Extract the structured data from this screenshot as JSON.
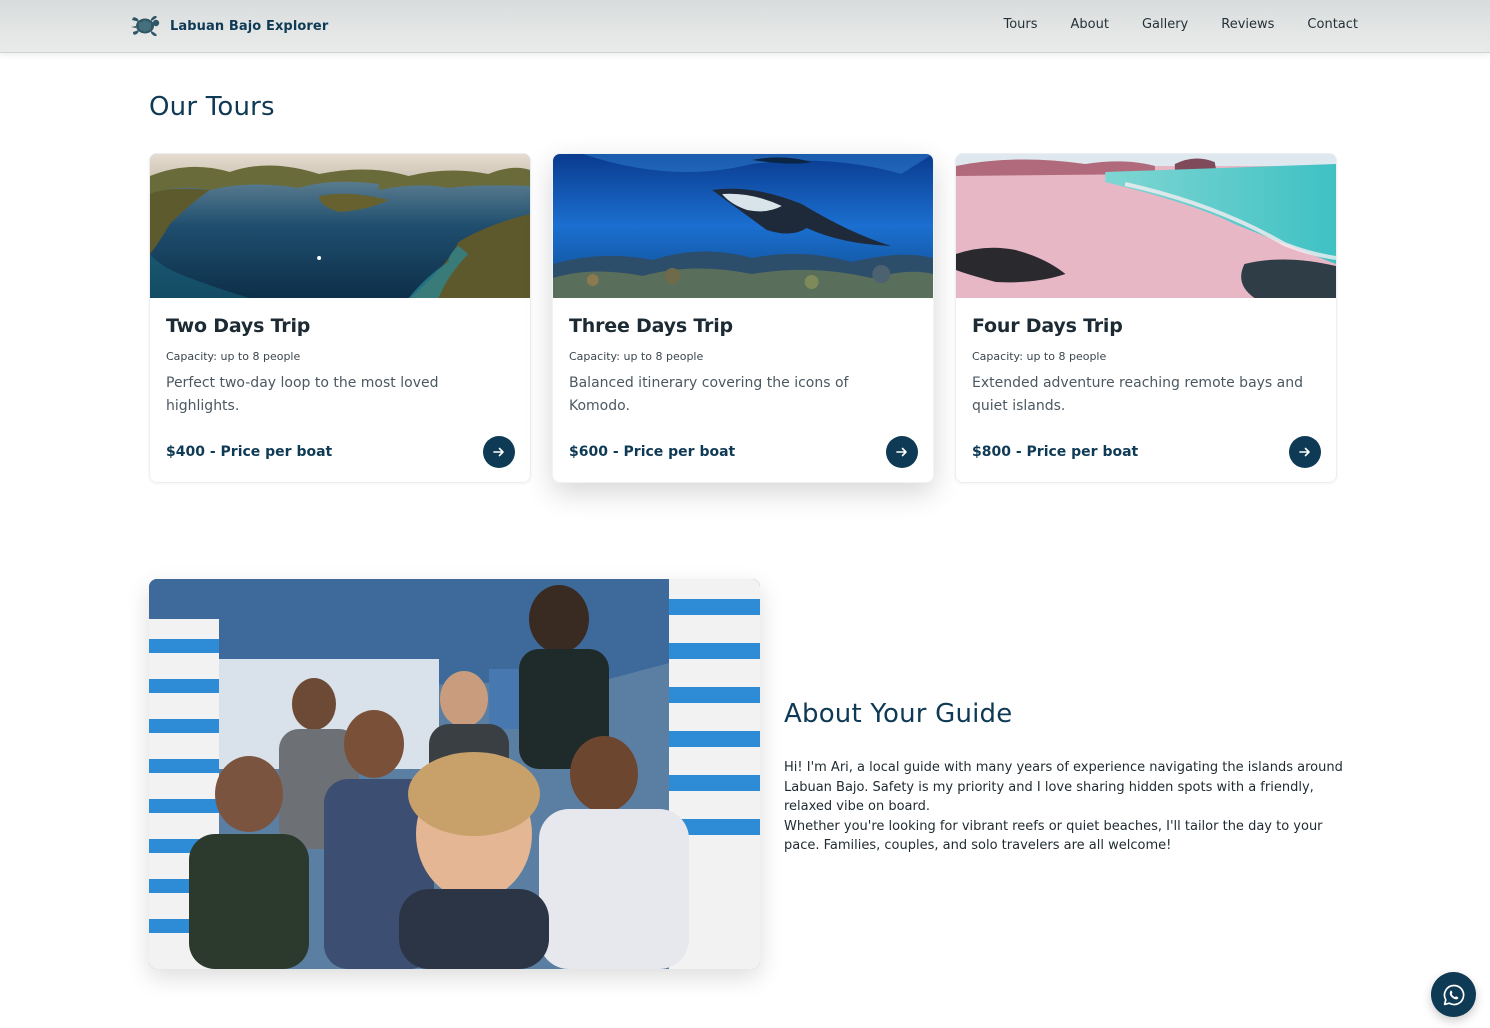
{
  "brand": {
    "name": "Labuan Bajo Explorer",
    "icon": "turtle-icon"
  },
  "nav": {
    "links": [
      "Tours",
      "About",
      "Gallery",
      "Reviews",
      "Contact"
    ]
  },
  "tours": {
    "title": "Our Tours",
    "cards": [
      {
        "image": "island-bay-aerial-image",
        "title": "Two Days Trip",
        "capacity": "Capacity: up to 8 people",
        "description": "Perfect two-day loop to the most loved highlights.",
        "price": "$400 - Price per boat",
        "action_icon": "arrow-right-icon"
      },
      {
        "image": "manta-ray-underwater-image",
        "title": "Three Days Trip",
        "capacity": "Capacity: up to 8 people",
        "description": "Balanced itinerary covering the icons of Komodo.",
        "price": "$600 - Price per boat",
        "action_icon": "arrow-right-icon"
      },
      {
        "image": "pink-beach-image",
        "title": "Four Days Trip",
        "capacity": "Capacity: up to 8 people",
        "description": "Extended adventure reaching remote bays and quiet islands.",
        "price": "$800 - Price per boat",
        "action_icon": "arrow-right-icon"
      }
    ]
  },
  "about": {
    "title": "About Your Guide",
    "photo": "guide-group-selfie-on-boat-image",
    "paragraph_1": "Hi! I'm Ari, a local guide with many years of experience navigating the islands around Labuan Bajo. Safety is my priority and I love sharing hidden spots with a friendly, relaxed vibe on board.",
    "paragraph_2": "Whether you're looking for vibrant reefs or quiet beaches, I'll tailor the day to your pace. Families, couples, and solo travelers are all welcome!"
  },
  "floating": {
    "whatsapp_icon": "whatsapp-icon"
  },
  "colors": {
    "primary": "#0f3a55",
    "text": "#1c2a33",
    "muted": "#4b5861"
  }
}
